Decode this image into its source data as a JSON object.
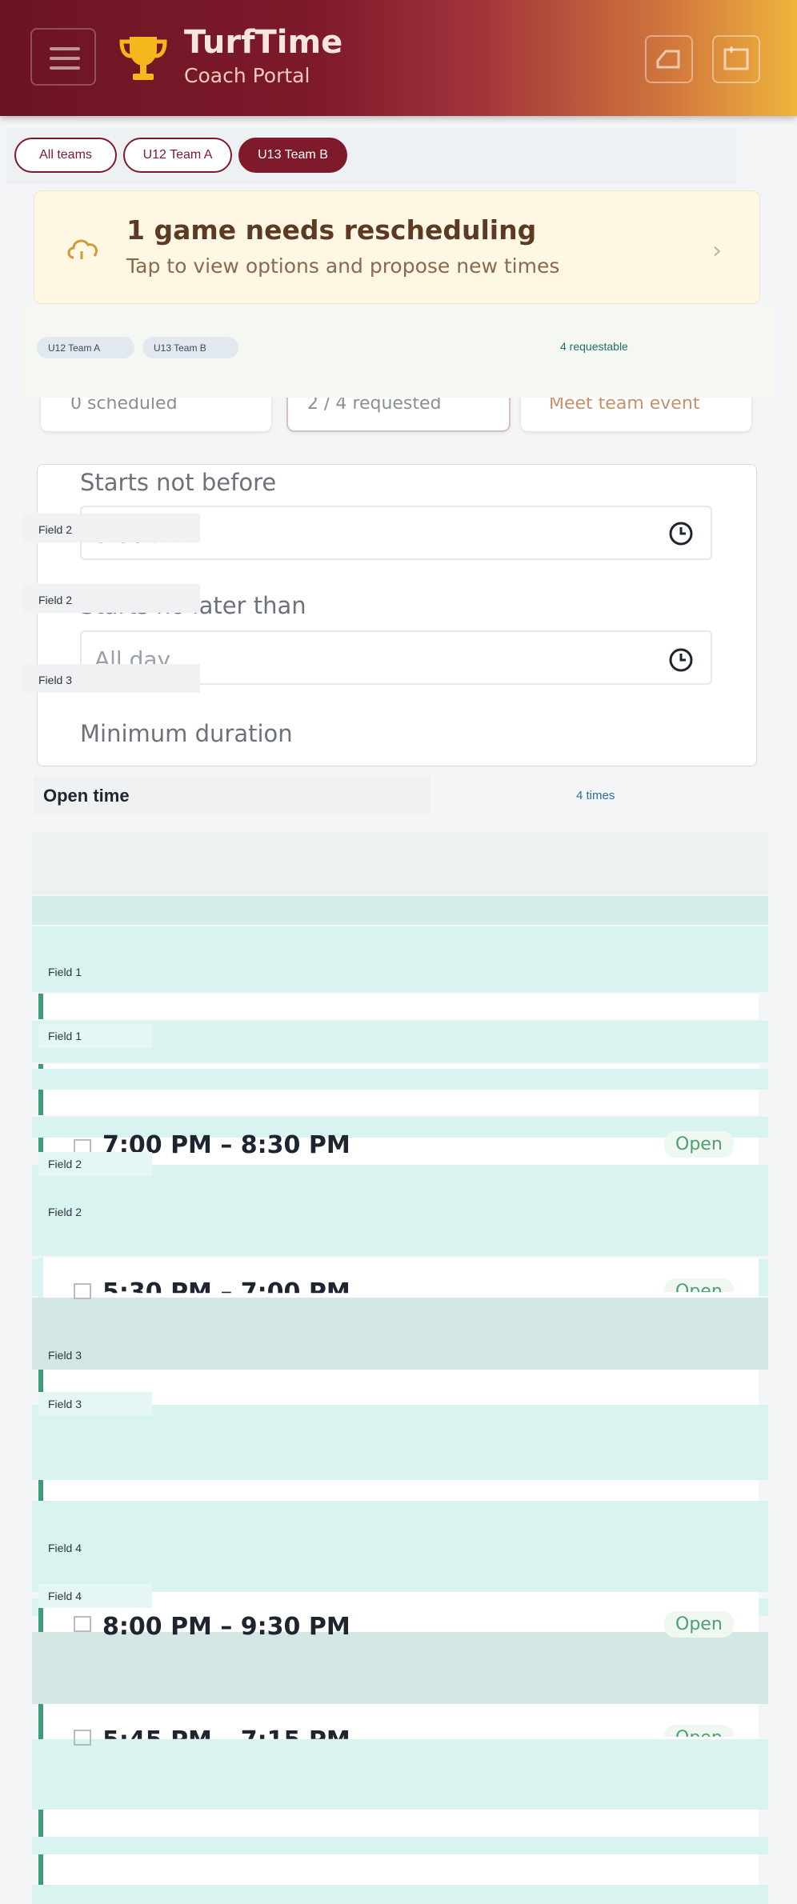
{
  "header": {
    "title": "TurfTime",
    "subtitle": "Coach Portal"
  },
  "team_chips": [
    {
      "label": "All teams",
      "active": false
    },
    {
      "label": "U12 Team A",
      "active": false
    },
    {
      "label": "U13 Team B",
      "active": true
    }
  ],
  "alert": {
    "title": "1 game needs rescheduling",
    "subtitle": "Tap to view options and propose new times"
  },
  "team_tags": [
    "U12 Team A",
    "U13 Team B"
  ],
  "requestable": "4 requestable",
  "stats": [
    "0 scheduled",
    "2 / 4 requested",
    "Meet team event"
  ],
  "filters": {
    "start_not_before_label": "Starts not before",
    "start_not_before_value": "5:00 PM",
    "start_no_later_label": "Starts no later than",
    "start_no_later_value": "All day",
    "min_duration_label": "Minimum duration"
  },
  "field_tags": [
    "Field 2",
    "Field 2",
    "Field 3"
  ],
  "open_time": {
    "title": "Open time",
    "count": "4 times"
  },
  "slot_groups": [
    {
      "label": "Field 1"
    },
    {
      "label": "Field 1"
    },
    {
      "label": "Field 2"
    },
    {
      "label": "Field 2"
    },
    {
      "label": "Field 3"
    },
    {
      "label": "Field 3"
    },
    {
      "label": "Field 4"
    },
    {
      "label": "Field 4"
    }
  ],
  "slots": [
    {
      "time": "7:00 PM – 8:30 PM",
      "status": "Open"
    },
    {
      "time": "5:30 PM – 7:00 PM",
      "status": "Open"
    },
    {
      "time": "8:00 PM – 9:30 PM",
      "status": "Open"
    },
    {
      "time": "5:45 PM – 7:15 PM",
      "status": "Open"
    }
  ],
  "colors": {
    "brand": "#7e1a2a",
    "accent": "#f0b43c",
    "slot_band": "#d9f2ef",
    "open_green": "#3e9b7c"
  }
}
